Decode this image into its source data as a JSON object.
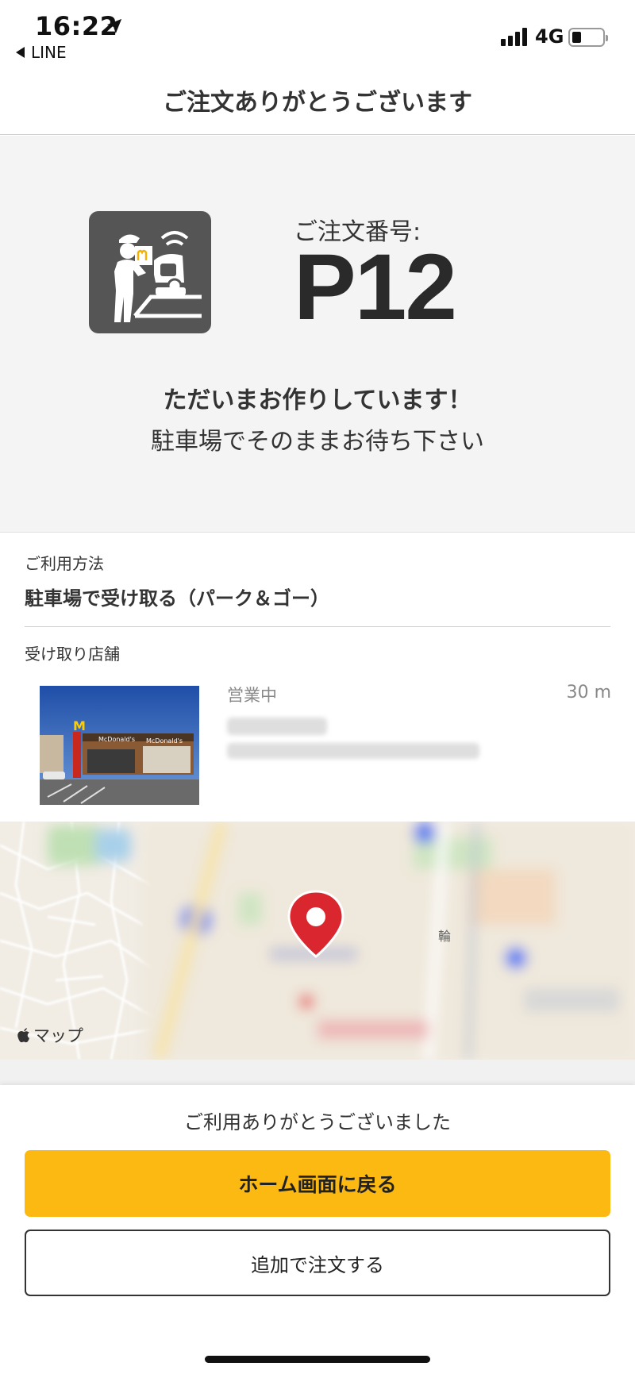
{
  "status_bar": {
    "time": "16:22",
    "back_app": "LINE",
    "network": "4G",
    "battery_level": 0.2
  },
  "header": {
    "title": "ご注文ありがとうございます"
  },
  "order": {
    "number_label": "ご注文番号:",
    "number": "P12",
    "status_message": "ただいまお作りしています！",
    "status_sub": "駐車場でそのままお待ち下さい",
    "icon": "park-and-go-icon"
  },
  "usage": {
    "label": "ご利用方法",
    "value": "駐車場で受け取る（パーク＆ゴー）"
  },
  "store": {
    "label": "受け取り店舗",
    "status": "営業中",
    "distance": "30 m"
  },
  "map": {
    "attribution": "マップ",
    "pin_color": "#d9262f"
  },
  "footer": {
    "thanks": "ご利用ありがとうございました",
    "home_button": "ホーム画面に戻る",
    "add_order_button": "追加で注文する"
  },
  "colors": {
    "accent": "#fcb912",
    "icon_bg": "#555555"
  }
}
